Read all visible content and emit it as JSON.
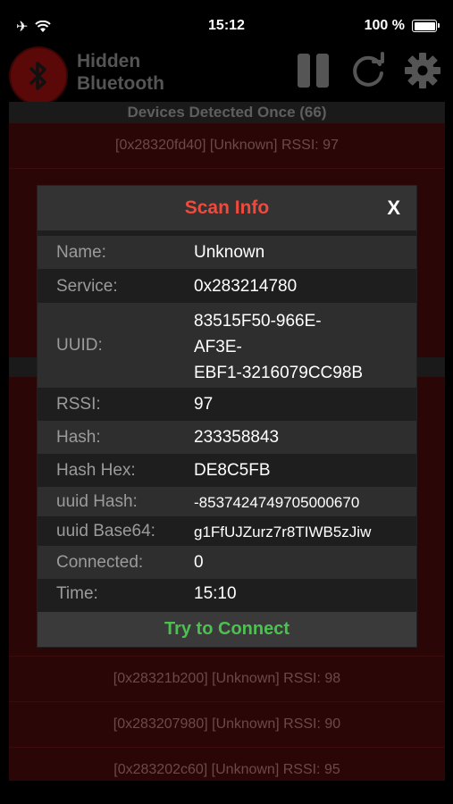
{
  "status_bar": {
    "time": "15:12",
    "battery": "100 %"
  },
  "app": {
    "title_line1": "Hidden",
    "title_line2": "Bluetooth"
  },
  "list": {
    "header": "Devices Detected Once (66)",
    "rows": [
      "[0x28320fd40] [Unknown] RSSI: 97",
      "[0x28321b200] [Unknown] RSSI: 98",
      "[0x283207980] [Unknown] RSSI: 90",
      "[0x283202c60] [Unknown] RSSI: 95"
    ]
  },
  "modal": {
    "title": "Scan Info",
    "close": "X",
    "fields": [
      {
        "label": "Name:",
        "value": "Unknown"
      },
      {
        "label": "Service:",
        "value": "0x283214780"
      },
      {
        "label": "UUID:",
        "value_lines": [
          "83515F50-966E-",
          "AF3E-",
          "EBF1-3216079CC98B"
        ]
      },
      {
        "label": "RSSI:",
        "value": "97"
      },
      {
        "label": "Hash:",
        "value": "233358843"
      },
      {
        "label": "Hash Hex:",
        "value": "DE8C5FB"
      },
      {
        "label": "uuid Hash:",
        "value": "-8537424749705000670"
      },
      {
        "label": "uuid Base64:",
        "value": "g1FfUJZurz7r8TIWB5zJiw"
      },
      {
        "label": "Connected:",
        "value": "0"
      },
      {
        "label": "Time:",
        "value": "15:10"
      }
    ],
    "connect_button": "Try to Connect"
  }
}
